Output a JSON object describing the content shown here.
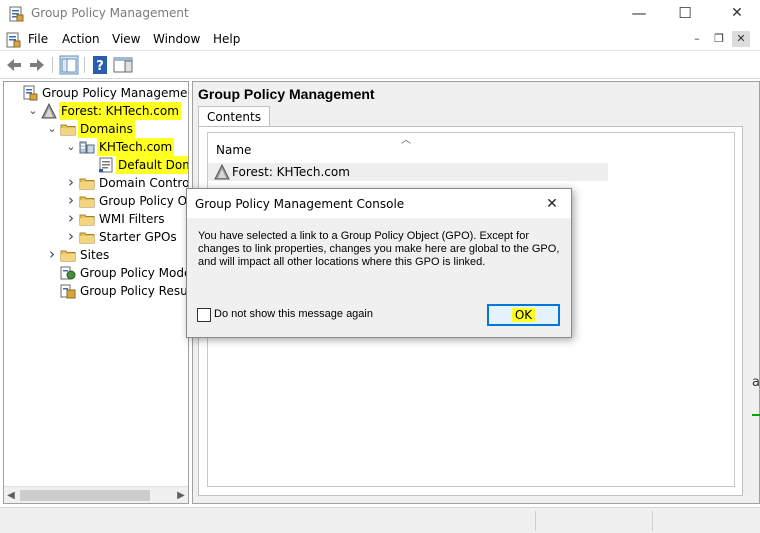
{
  "window": {
    "title": "Group Policy Management",
    "controls": {
      "minimize": "—",
      "maximize": "☐",
      "close": "✕"
    }
  },
  "menu": {
    "items": [
      "File",
      "Action",
      "View",
      "Window",
      "Help"
    ],
    "mdi_controls": {
      "minimize": "–",
      "restore": "❐",
      "close": "✕"
    }
  },
  "tree": {
    "items": [
      {
        "label": "Group Policy Management",
        "icon": "gpm-icon"
      },
      {
        "label": "Forest: KHTech.com",
        "icon": "forest-icon",
        "highlighted": true,
        "expanded": true
      },
      {
        "label": "Domains",
        "icon": "folder-icon",
        "highlighted": true,
        "expanded": true
      },
      {
        "label": "KHTech.com",
        "icon": "domain-icon",
        "highlighted": true,
        "expanded": true
      },
      {
        "label": "Default Domain",
        "icon": "gpo-link-icon",
        "highlighted": true
      },
      {
        "label": "Domain Contro",
        "icon": "folder-icon",
        "collapsed": true
      },
      {
        "label": "Group Policy O",
        "icon": "folder-icon",
        "collapsed": true
      },
      {
        "label": "WMI Filters",
        "icon": "folder-icon",
        "collapsed": true
      },
      {
        "label": "Starter GPOs",
        "icon": "folder-icon",
        "collapsed": true
      },
      {
        "label": "Sites",
        "icon": "folder-icon",
        "collapsed": true
      },
      {
        "label": "Group Policy Modeling",
        "icon": "modeling-icon"
      },
      {
        "label": "Group Policy Results",
        "icon": "results-icon"
      }
    ]
  },
  "right": {
    "title": "Group Policy Management",
    "tab": "Contents",
    "column": "Name",
    "rows": [
      {
        "label": "Forest: KHTech.com",
        "icon": "forest-icon"
      }
    ]
  },
  "dialog": {
    "title": "Group Policy Management Console",
    "message": "You have selected a link to a Group Policy Object (GPO). Except for changes to link properties, changes you make here are global to the GPO, and will impact all other locations where this GPO is linked.",
    "checkbox_label": "Do not show this message again",
    "ok_label": "OK",
    "close": "✕"
  },
  "edge": {
    "char": "a"
  },
  "colors": {
    "highlight": "#ffff22",
    "focus_border": "#0078d7",
    "ok_bg": "#e5f1fb"
  }
}
